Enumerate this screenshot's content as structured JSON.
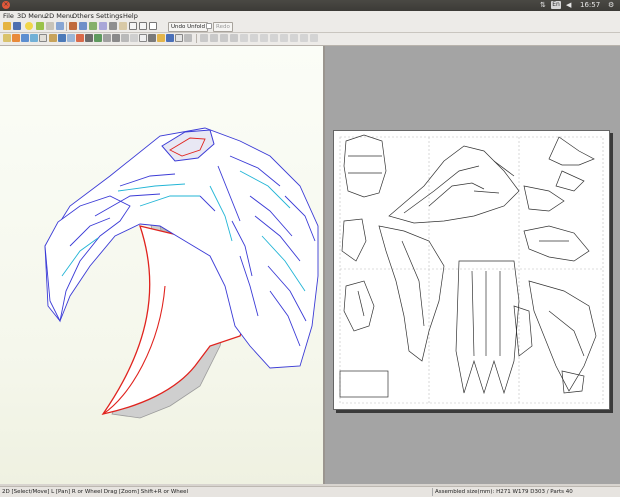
{
  "system_bar": {
    "keyboard_layout": "En",
    "time": "16:57"
  },
  "menu": {
    "items": [
      "File",
      "3D Menu",
      "2D Menu",
      "Others",
      "Settings",
      "Help"
    ]
  },
  "toolbar": {
    "undo_unfold_label": "Undo Unfold",
    "redo_label": "Redo"
  },
  "status_bar": {
    "hint": "2D [Select/Move] L [Pan] R or Wheel Drag [Zoom] Shift+R or Wheel",
    "info": "Assembled size(mm): H271 W179 D303 / Parts 40"
  },
  "colors": {
    "cut_edge": "#e0231e",
    "mountain_fold": "#3b3bd6",
    "valley_fold": "#22b5d6",
    "sheet_background": "#ffffff",
    "workspace_background": "#a4a4a4"
  }
}
